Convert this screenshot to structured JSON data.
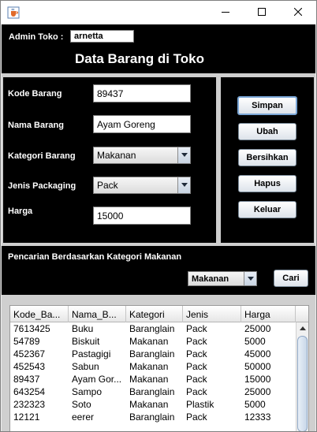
{
  "window": {
    "app_icon": "java-cup-icon"
  },
  "titlebar": {
    "minimize_icon": "minimize-icon",
    "maximize_icon": "maximize-icon",
    "close_icon": "close-icon"
  },
  "header": {
    "admin_label": "Admin Toko :",
    "admin_value": "arnetta",
    "title": "Data Barang di Toko"
  },
  "form": {
    "kode_label": "Kode Barang",
    "kode_value": "89437",
    "nama_label": "Nama Barang",
    "nama_value": "Ayam Goreng",
    "kategori_label": "Kategori Barang",
    "kategori_value": "Makanan",
    "packaging_label": "Jenis Packaging",
    "packaging_value": "Pack",
    "harga_label": "Harga",
    "harga_value": "15000"
  },
  "actions": {
    "simpan": "Simpan",
    "ubah": "Ubah",
    "bersihkan": "Bersihkan",
    "hapus": "Hapus",
    "keluar": "Keluar"
  },
  "search": {
    "label": "Pencarian Berdasarkan Kategori Makanan",
    "category_value": "Makanan",
    "button": "Cari"
  },
  "table": {
    "columns": [
      "Kode_Ba...",
      "Nama_B...",
      "Kategori",
      "Jenis",
      "Harga"
    ],
    "rows": [
      [
        "7613425",
        "Buku",
        "Baranglain",
        "Pack",
        "25000"
      ],
      [
        "54789",
        "Biskuit",
        "Makanan",
        "Pack",
        "5000"
      ],
      [
        "452367",
        "Pastagigi",
        "Baranglain",
        "Pack",
        "45000"
      ],
      [
        "452543",
        "Sabun",
        "Makanan",
        "Pack",
        "50000"
      ],
      [
        "89437",
        "Ayam Gor...",
        "Makanan",
        "Pack",
        "15000"
      ],
      [
        "643254",
        "Sampo",
        "Baranglain",
        "Pack",
        "25000"
      ],
      [
        "232323",
        "Soto",
        "Makanan",
        "Plastik",
        "5000"
      ],
      [
        "12121",
        "eerer",
        "Baranglain",
        "Pack",
        "12333"
      ]
    ]
  },
  "colors": {
    "panel_bg": "#000000",
    "frame_bg": "#cfcfcf",
    "button_focus": "#7aa6d6"
  }
}
